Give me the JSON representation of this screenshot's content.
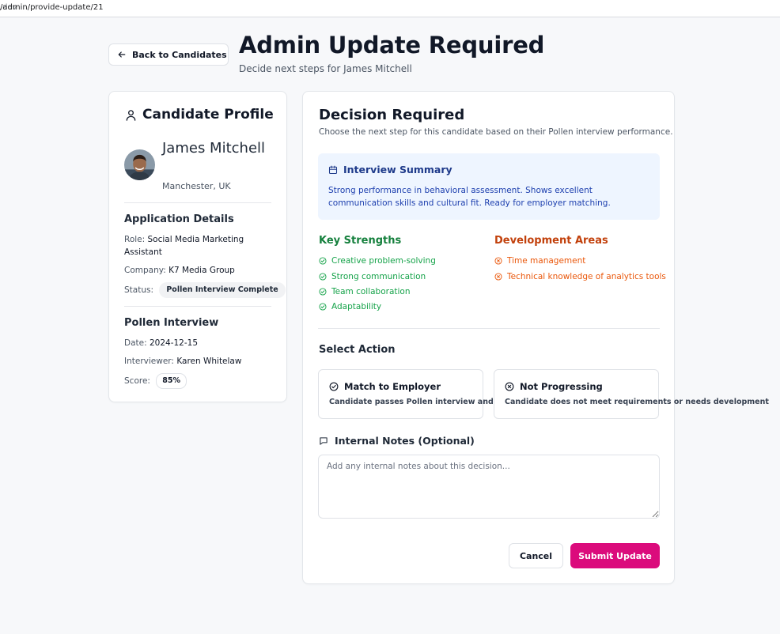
{
  "browser": {
    "url_dim": ".dev",
    "url_path": "/admin/provide-update/21"
  },
  "header": {
    "back_label": "Back to Candidates",
    "title": "Admin Update Required",
    "subtitle": "Decide next steps for James Mitchell"
  },
  "profile": {
    "heading": "Candidate Profile",
    "name": "James Mitchell",
    "location": "Manchester, UK",
    "application": {
      "heading": "Application Details",
      "role_key": "Role:",
      "role_value": "Social Media Marketing Assistant",
      "company_key": "Company:",
      "company_value": "K7 Media Group",
      "status_key": "Status:",
      "status_value": "Pollen Interview Complete"
    },
    "interview": {
      "heading": "Pollen Interview",
      "date_key": "Date:",
      "date_value": "2024-12-15",
      "interviewer_key": "Interviewer:",
      "interviewer_value": "Karen Whitelaw",
      "score_key": "Score:",
      "score_value": "85%"
    }
  },
  "decision": {
    "title": "Decision Required",
    "subtitle": "Choose the next step for this candidate based on their Pollen interview performance.",
    "summary": {
      "title": "Interview Summary",
      "text": "Strong performance in behavioral assessment. Shows excellent communication skills and cultural fit. Ready for employer matching."
    },
    "strengths_heading": "Key Strengths",
    "strengths": [
      "Creative problem-solving",
      "Strong communication",
      "Team collaboration",
      "Adaptability"
    ],
    "development_heading": "Development Areas",
    "development": [
      "Time management",
      "Technical knowledge of analytics tools"
    ],
    "select_action_heading": "Select Action",
    "actions": [
      {
        "title": "Match to Employer",
        "description": "Candidate passes Pollen interview and is ready for employer review",
        "icon": "check-circle-icon"
      },
      {
        "title": "Not Progressing",
        "description": "Candidate does not meet requirements or needs development",
        "icon": "x-circle-icon"
      }
    ],
    "notes_label": "Internal Notes (Optional)",
    "notes_placeholder": "Add any internal notes about this decision...",
    "notes_value": "",
    "cancel_label": "Cancel",
    "submit_label": "Submit Update"
  },
  "colors": {
    "accent": "#db0b7c",
    "strengths": "#16a34a",
    "development": "#ea580c",
    "summary_bg": "#eef5ff",
    "summary_text": "#1e40af"
  }
}
